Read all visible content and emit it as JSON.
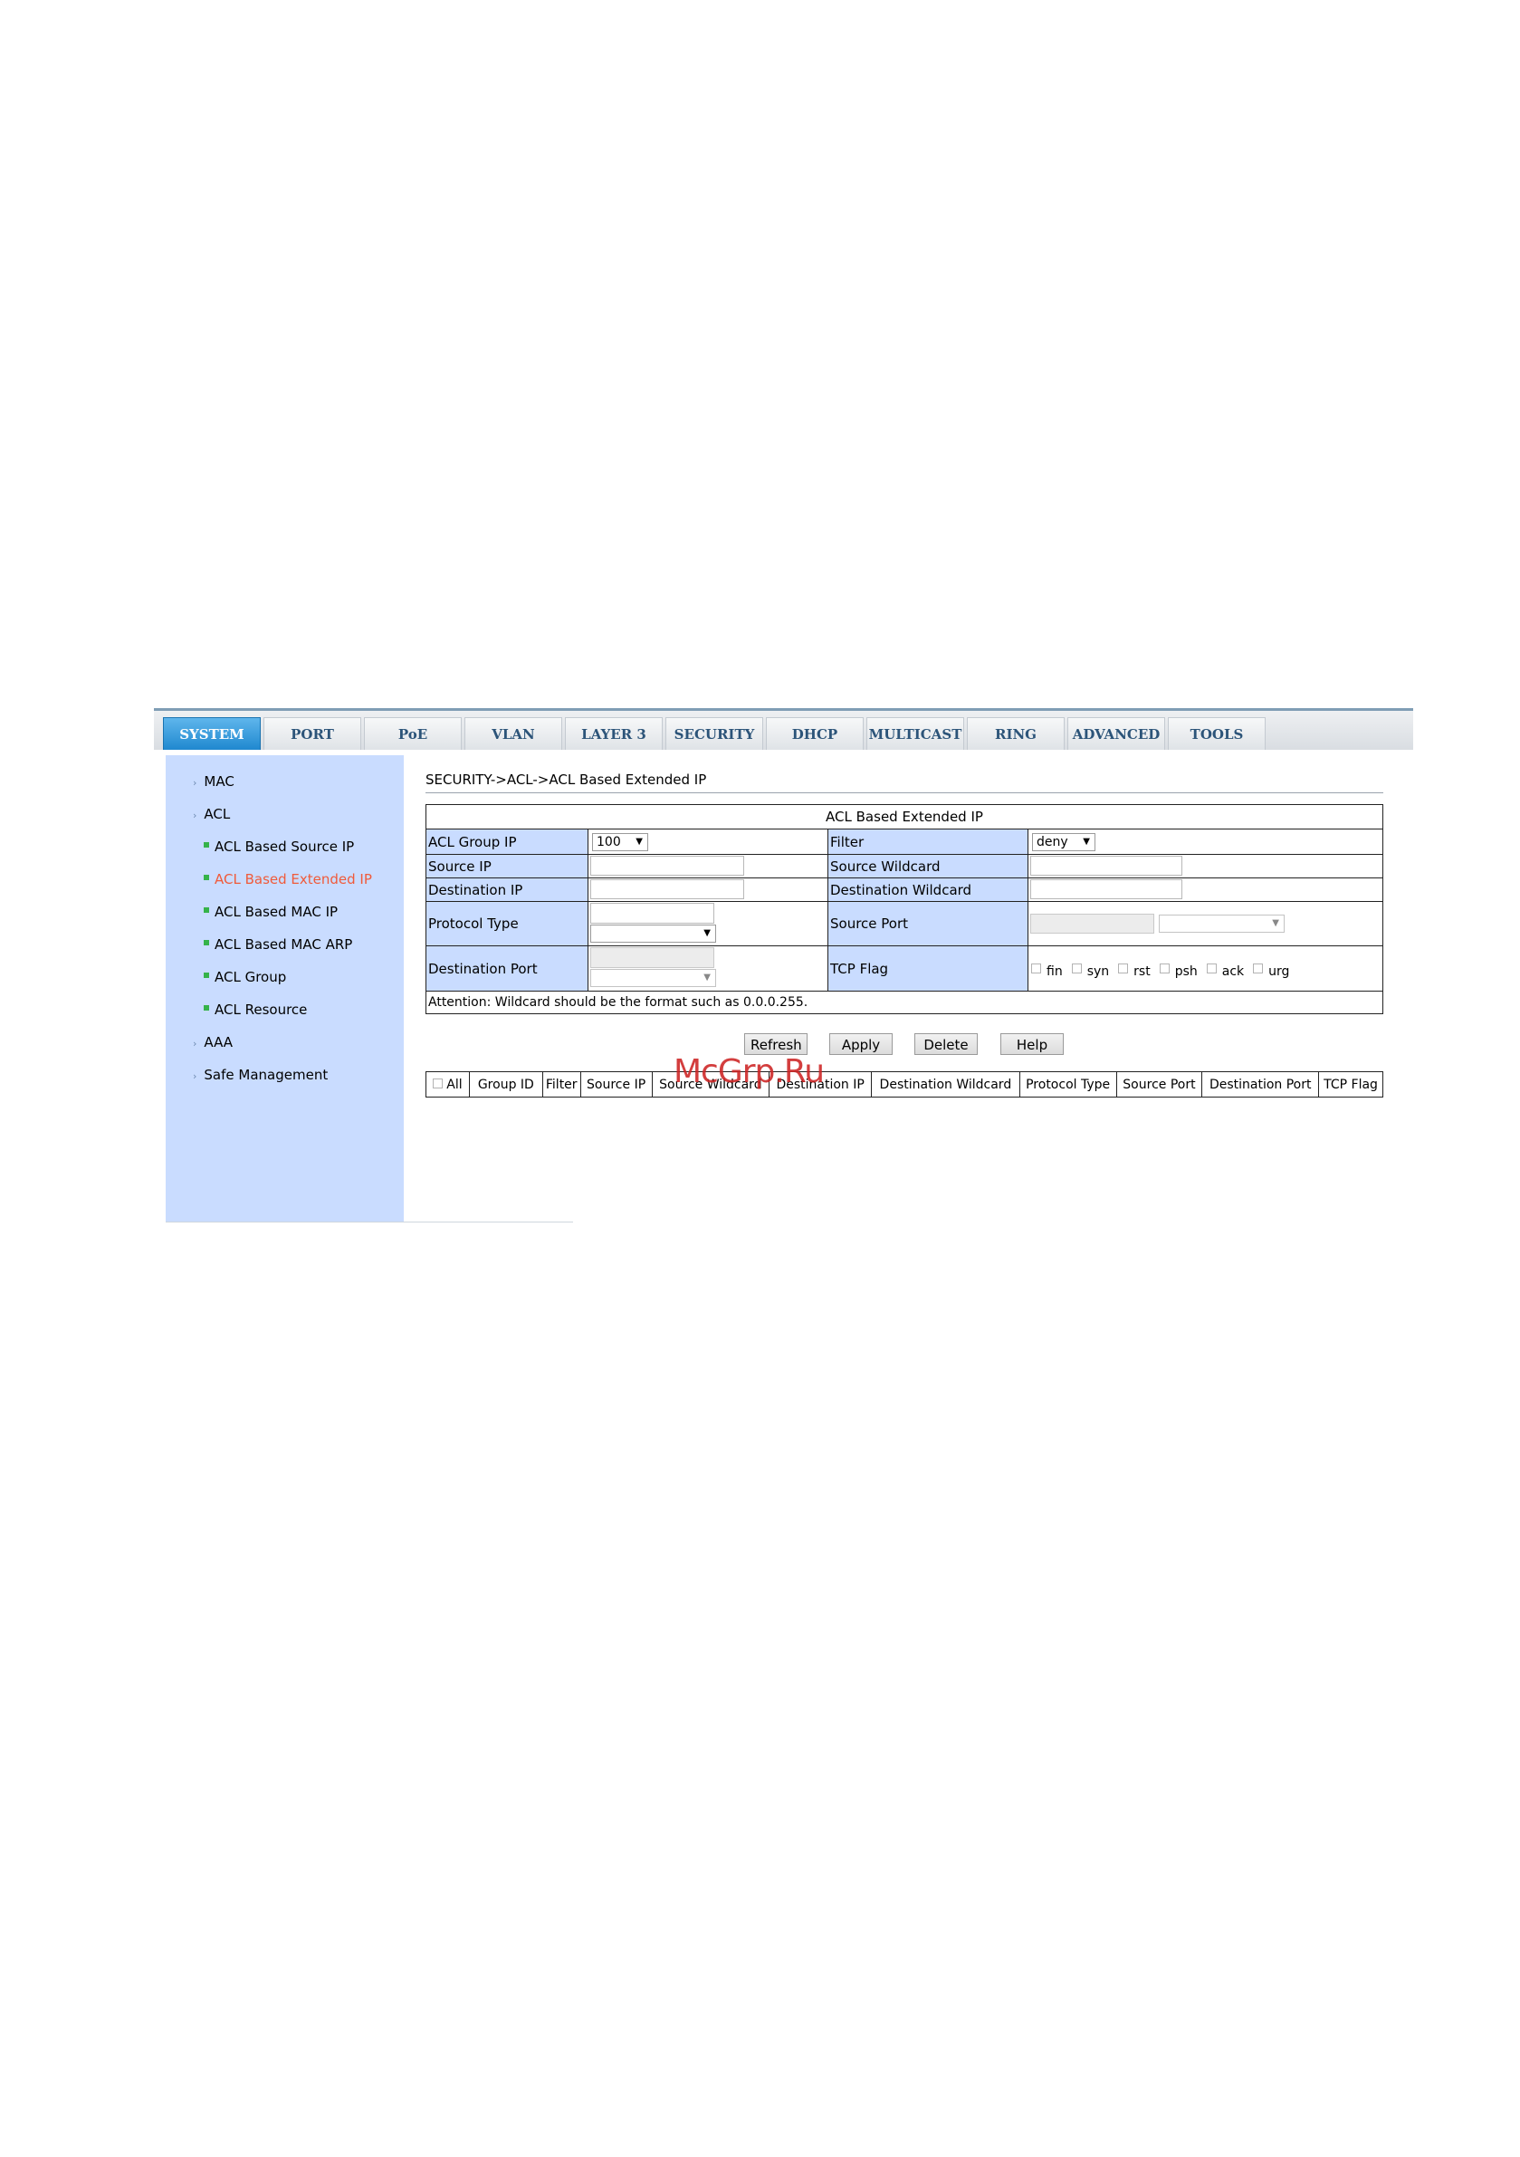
{
  "nav_tabs": [
    {
      "label": "SYSTEM",
      "active": true
    },
    {
      "label": "PORT",
      "active": false
    },
    {
      "label": "PoE",
      "active": false
    },
    {
      "label": "VLAN",
      "active": false
    },
    {
      "label": "LAYER 3",
      "active": false
    },
    {
      "label": "SECURITY",
      "active": false
    },
    {
      "label": "DHCP",
      "active": false
    },
    {
      "label": "MULTICAST",
      "active": false
    },
    {
      "label": "RING",
      "active": false
    },
    {
      "label": "ADVANCED",
      "active": false
    },
    {
      "label": "TOOLS",
      "active": false
    }
  ],
  "sidebar": {
    "items": [
      {
        "label": "MAC",
        "level": 1
      },
      {
        "label": "ACL",
        "level": 1
      },
      {
        "label": "ACL Based Source IP",
        "level": 2
      },
      {
        "label": "ACL Based Extended IP",
        "level": 2,
        "active": true
      },
      {
        "label": "ACL Based MAC IP",
        "level": 2
      },
      {
        "label": "ACL Based MAC ARP",
        "level": 2
      },
      {
        "label": "ACL Group",
        "level": 2
      },
      {
        "label": "ACL Resource",
        "level": 2
      },
      {
        "label": "AAA",
        "level": 1
      },
      {
        "label": "Safe Management",
        "level": 1
      }
    ]
  },
  "breadcrumb": "SECURITY->ACL->ACL Based Extended IP",
  "form": {
    "title": "ACL Based Extended IP",
    "acl_group_ip_label": "ACL Group IP",
    "acl_group_ip_value": "100",
    "filter_label": "Filter",
    "filter_value": "deny",
    "source_ip_label": "Source IP",
    "source_ip_value": "",
    "source_wildcard_label": "Source Wildcard",
    "source_wildcard_value": "",
    "destination_ip_label": "Destination IP",
    "destination_ip_value": "",
    "destination_wildcard_label": "Destination Wildcard",
    "destination_wildcard_value": "",
    "protocol_type_label": "Protocol Type",
    "protocol_type_value": "",
    "protocol_type_select": "",
    "source_port_label": "Source Port",
    "source_port_value": "",
    "source_port_select": "",
    "destination_port_label": "Destination Port",
    "destination_port_value": "",
    "destination_port_select": "",
    "tcp_flag_label": "TCP Flag",
    "tcp_flags": [
      "fin",
      "syn",
      "rst",
      "psh",
      "ack",
      "urg"
    ],
    "attention": "Attention: Wildcard should be the format such as 0.0.0.255."
  },
  "buttons": {
    "refresh": "Refresh",
    "apply": "Apply",
    "delete": "Delete",
    "help": "Help"
  },
  "table": {
    "headers": [
      "All",
      "Group ID",
      "Filter",
      "Source IP",
      "Source Wildcard",
      "Destination IP",
      "Destination Wildcard",
      "Protocol Type",
      "Source Port",
      "Destination Port",
      "TCP Flag"
    ]
  },
  "watermark": "McGrp.Ru",
  "colors": {
    "sidebar_bg": "#c9dcff",
    "label_bg": "#c9dcff",
    "active_tab": "#1f88cf",
    "active_link": "#f05a3a",
    "bullet": "#35b34a",
    "watermark": "#cd2323"
  }
}
